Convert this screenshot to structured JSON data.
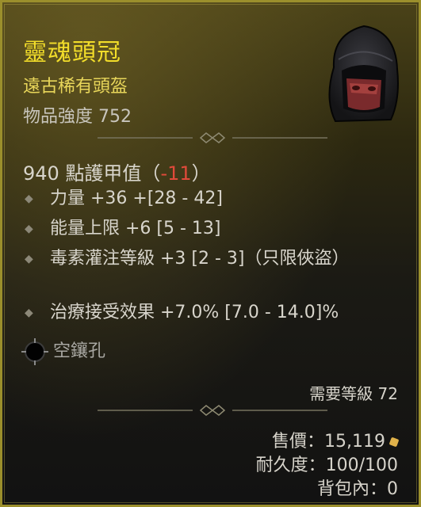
{
  "item": {
    "name": "靈魂頭冠",
    "rarity": "遠古稀有頭盔",
    "item_power": "物品強度 752",
    "armor_prefix": "940 點護甲值（",
    "armor_delta": "-11",
    "armor_suffix": "）"
  },
  "affixes": [
    {
      "text": "力量 +36 +[28 - 42]"
    },
    {
      "text": "能量上限 +6 [5 - 13]"
    },
    {
      "text": "毒素灌注等級 +3 [2 - 3]（只限俠盜）"
    },
    {
      "text": "治療接受效果 +7.0% [7.0 - 14.0]%"
    }
  ],
  "socket": {
    "label": "空鑲孔"
  },
  "requirement": "需要等級 72",
  "footer": {
    "sell": "售價：15,119",
    "durability": "耐久度：100/100",
    "inventory": "背包內：0"
  },
  "colors": {
    "legendary_name": "#f2dd2a",
    "rarity_text": "#e8d65a",
    "negative": "#e04a3a",
    "border": "#9b8f2c",
    "gold_icon": "#e0b24a"
  },
  "icons": [
    "helm-portrait-icon",
    "socket-icon",
    "gold-coin-icon",
    "divider-ornament-icon"
  ]
}
